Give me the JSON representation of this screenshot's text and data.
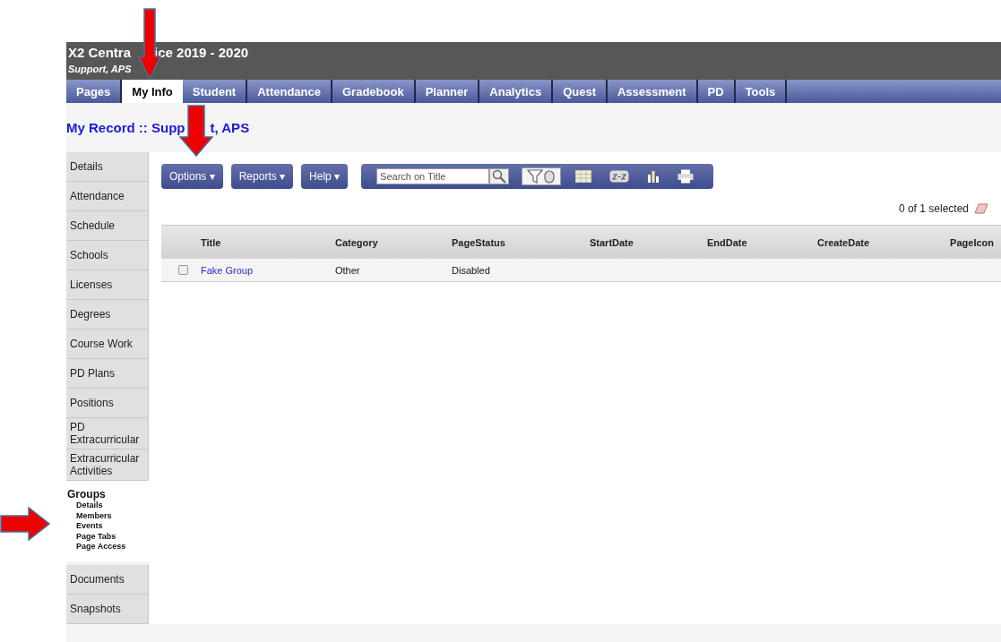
{
  "header": {
    "title_parts": [
      "X2 Centra",
      "ice 2019 - 2020"
    ],
    "user": "Support, APS"
  },
  "tabs": [
    {
      "label": "Pages",
      "selected": false
    },
    {
      "label": "My Info",
      "selected": true
    },
    {
      "label": "Student",
      "selected": false
    },
    {
      "label": "Attendance",
      "selected": false
    },
    {
      "label": "Gradebook",
      "selected": false
    },
    {
      "label": "Planner",
      "selected": false
    },
    {
      "label": "Analytics",
      "selected": false
    },
    {
      "label": "Quest",
      "selected": false
    },
    {
      "label": "Assessment",
      "selected": false
    },
    {
      "label": "PD",
      "selected": false
    },
    {
      "label": "Tools",
      "selected": false
    }
  ],
  "record_title_parts": [
    "My Record :: Supp",
    "t, APS"
  ],
  "sidebar": {
    "items": [
      {
        "label": "Details",
        "selected": false
      },
      {
        "label": "Attendance",
        "selected": false
      },
      {
        "label": "Schedule",
        "selected": false
      },
      {
        "label": "Schools",
        "selected": false
      },
      {
        "label": "Licenses",
        "selected": false
      },
      {
        "label": "Degrees",
        "selected": false
      },
      {
        "label": "Course Work",
        "selected": false
      },
      {
        "label": "PD Plans",
        "selected": false
      },
      {
        "label": "Positions",
        "selected": false
      },
      {
        "label": "PD Extracurricular",
        "selected": false
      },
      {
        "label": "Extracurricular Activities",
        "selected": false
      },
      {
        "label": "Groups",
        "selected": true,
        "children": [
          {
            "label": "Details"
          },
          {
            "label": "Members"
          },
          {
            "label": "Events"
          },
          {
            "label": "Page Tabs"
          },
          {
            "label": "Page Access"
          }
        ]
      },
      {
        "label": "Documents",
        "selected": false
      },
      {
        "label": "Snapshots",
        "selected": false
      }
    ]
  },
  "toolbar": {
    "menus": [
      "Options",
      "Reports",
      "Help"
    ],
    "caret": "▾",
    "search": {
      "placeholder": "Search on Title"
    },
    "filter_on": true
  },
  "selection": "0 of 1 selected",
  "table": {
    "columns": [
      "Title",
      "Category",
      "PageStatus",
      "StartDate",
      "EndDate",
      "CreateDate",
      "PageIcon"
    ],
    "rows": [
      {
        "checked": false,
        "cells": [
          "Fake Group",
          "Other",
          "Disabled"
        ]
      }
    ]
  }
}
